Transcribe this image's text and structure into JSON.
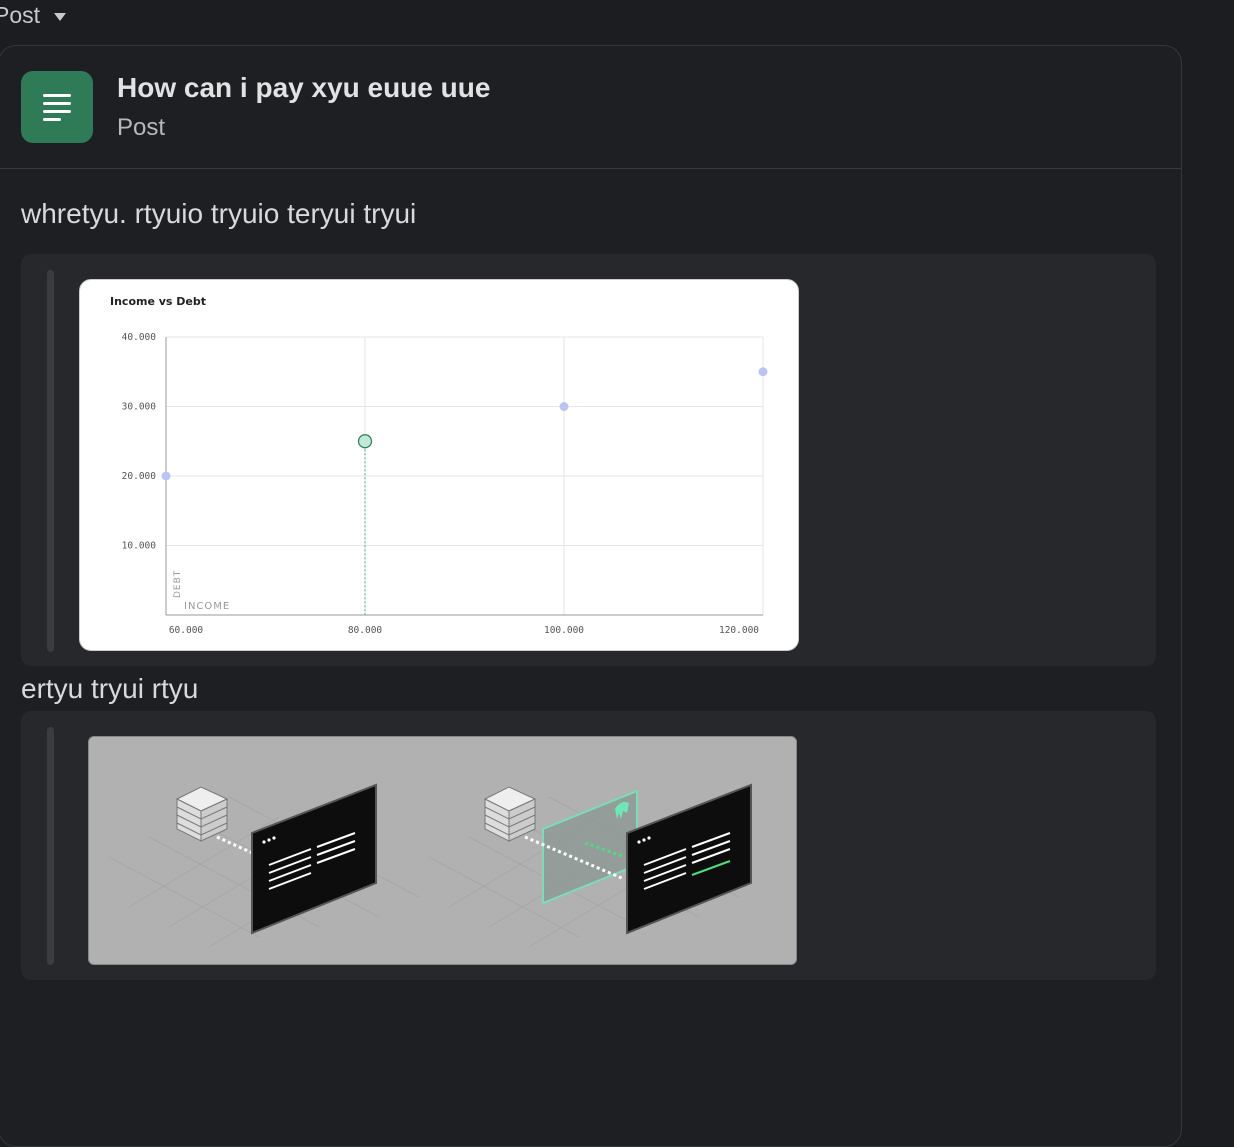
{
  "top": {
    "post_label": "Post"
  },
  "post": {
    "title": "How can i pay xyu euue uue",
    "type_label": "Post",
    "paragraph_1": "whretyu. rtyuio tryuio teryui tryui",
    "paragraph_2": "ertyu tryui rtyu"
  },
  "colors": {
    "accent": "#2f7a57",
    "background": "#1b1d21",
    "card": "#26282c"
  },
  "chart_data": {
    "type": "scatter",
    "title": "Income vs Debt",
    "xlabel": "INCOME",
    "ylabel": "DEBT",
    "xlim": [
      60000,
      120000
    ],
    "ylim": [
      0,
      40000
    ],
    "x_ticks": [
      "60.000",
      "80.000",
      "100.000",
      "120.000"
    ],
    "y_ticks": [
      "10.000",
      "20.000",
      "30.000",
      "40.000"
    ],
    "points": [
      {
        "x": 60000,
        "y": 20000
      },
      {
        "x": 80000,
        "y": 25000,
        "highlighted": true
      },
      {
        "x": 100000,
        "y": 30000
      },
      {
        "x": 120000,
        "y": 35000
      }
    ],
    "grid": true
  }
}
